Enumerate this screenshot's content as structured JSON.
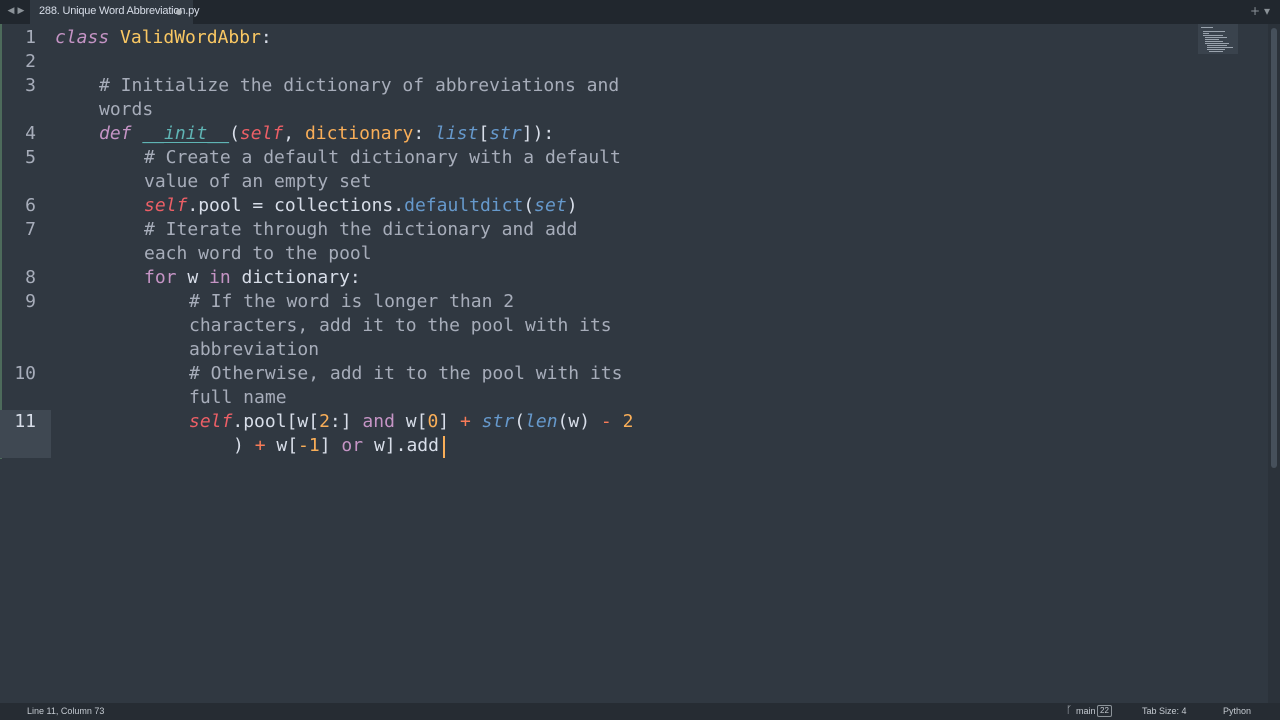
{
  "tabbar": {
    "back_label": "◀",
    "forward_label": "▶",
    "tab_title": "288. Unique Word Abbreviation.py",
    "add_label": "+",
    "menu_label": "▾"
  },
  "editor": {
    "line_numbers": [
      "1",
      "2",
      "3",
      "4",
      "5",
      "6",
      "7",
      "8",
      "9",
      "10",
      "11"
    ],
    "code": {
      "l1_kw": "class",
      "l1_name": "ValidWordAbbr",
      "l1_colon": ":",
      "l3_a": "# Initialize the dictionary of abbreviations and",
      "l3_b": "words",
      "l4_def": "def",
      "l4_name": "__init__",
      "l4_p1": "(",
      "l4_self": "self",
      "l4_comma": ", ",
      "l4_param": "dictionary",
      "l4_colon": ": ",
      "l4_list": "list",
      "l4_b1": "[",
      "l4_str": "str",
      "l4_end": "]):",
      "l5_a": "# Create a default dictionary with a default",
      "l5_b": "value of an empty set",
      "l6_self": "self",
      "l6_a": ".pool = collections.",
      "l6_fn": "defaultdict",
      "l6_p1": "(",
      "l6_set": "set",
      "l6_p2": ")",
      "l7_a": "# Iterate through the dictionary and add",
      "l7_b": "each word to the pool",
      "l8_for": "for",
      "l8_w": " w ",
      "l8_in": "in",
      "l8_rest": " dictionary:",
      "l9_a": "# If the word is longer than 2",
      "l9_b": "characters, add it to the pool with its",
      "l9_c": "abbreviation",
      "l10_a": "# Otherwise, add it to the pool with its",
      "l10_b": "full name",
      "l11_self": "self",
      "l11_a": ".pool[w[",
      "l11_n2": "2",
      "l11_b": ":] ",
      "l11_and": "and",
      "l11_c": " w[",
      "l11_n0": "0",
      "l11_d": "] ",
      "l11_plus": "+",
      "l11_e": " ",
      "l11_str": "str",
      "l11_f": "(",
      "l11_len": "len",
      "l11_g": "(w) ",
      "l11_minus": "-",
      "l11_h": " ",
      "l11_n2b": "2",
      "l11w_a": ") ",
      "l11w_plus": "+",
      "l11w_b": " w[",
      "l11w_neg": "-1",
      "l11w_c": "] ",
      "l11w_or": "or",
      "l11w_d": " w].add"
    }
  },
  "statusbar": {
    "position": "Line 11, Column 73",
    "branch": "main",
    "branch_count": "22",
    "tab_size": "Tab Size: 4",
    "syntax": "Python"
  }
}
